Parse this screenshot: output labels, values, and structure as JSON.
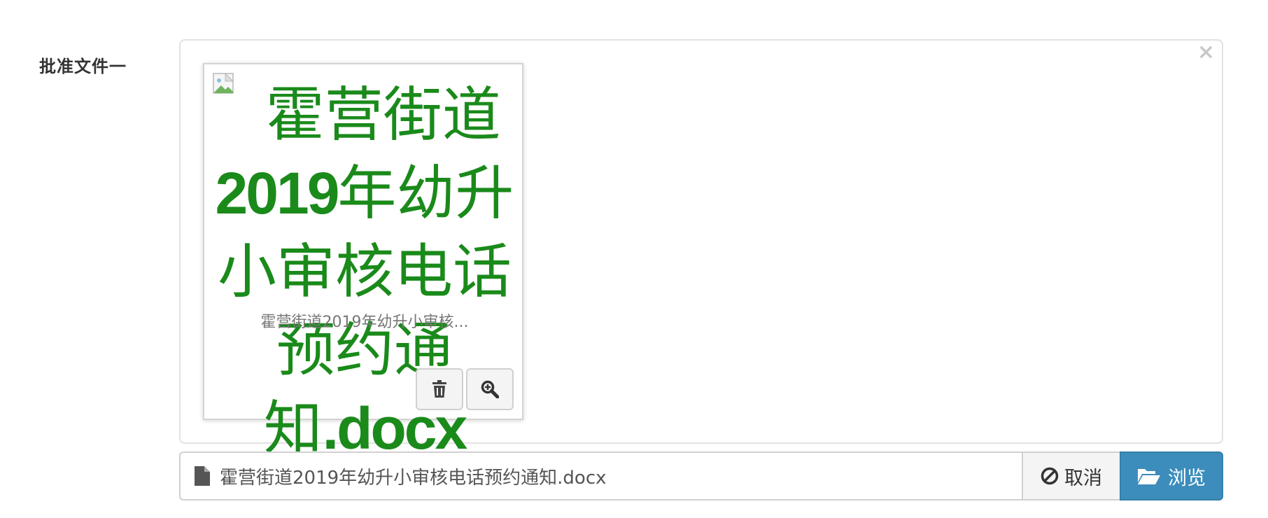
{
  "field": {
    "label": "批准文件一"
  },
  "preview": {
    "close_symbol": "×",
    "alt_lines": [
      "霍营街道",
      "2019|年幼升",
      "小审核电话",
      "预约通",
      "知|.docx"
    ],
    "caption": "霍营街道2019年幼升小审核...",
    "actions": {
      "delete_icon": "trash-icon",
      "zoom_icon": "zoom-in-icon"
    }
  },
  "input": {
    "file_icon": "file-icon",
    "filename": "霍营街道2019年幼升小审核电话预约通知.docx",
    "cancel_label": "取消",
    "browse_label": "浏览"
  },
  "colors": {
    "alt_text_green": "#1a8a1a",
    "browse_blue": "#3c8dbc"
  }
}
